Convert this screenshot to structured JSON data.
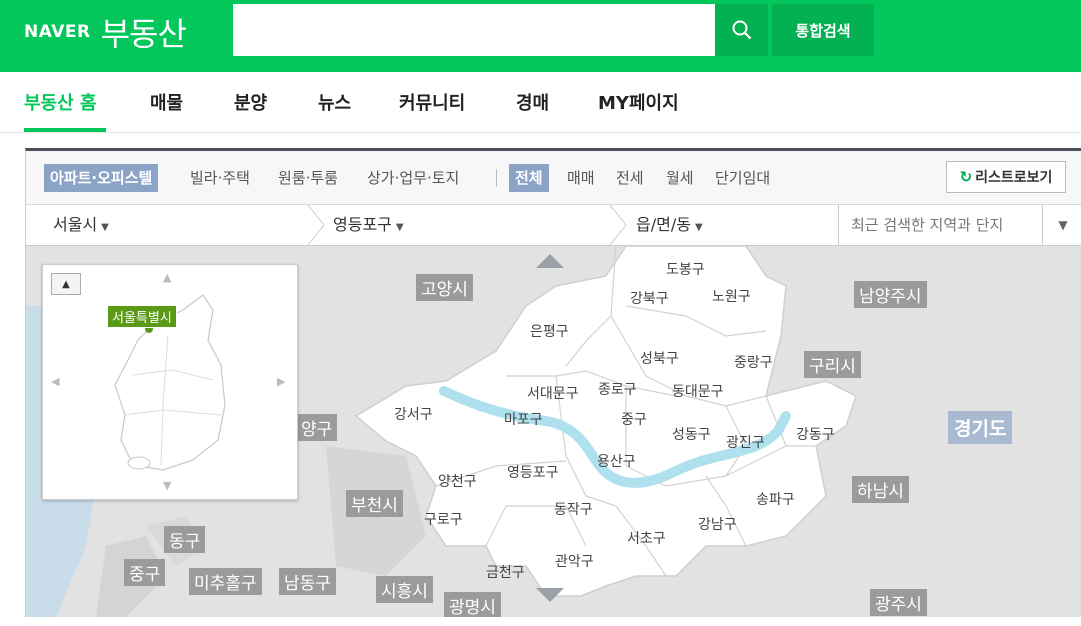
{
  "header": {
    "brand": "NAVER",
    "service": "부동산",
    "search": {
      "value": "",
      "placeholder": ""
    },
    "search_button_icon": "search-icon",
    "total_search_label": "통합검색"
  },
  "nav": {
    "items": [
      "부동산 홈",
      "매물",
      "분양",
      "뉴스",
      "커뮤니티",
      "경매",
      "MY페이지"
    ],
    "active": "부동산 홈"
  },
  "filters": {
    "property_types": [
      "아파트·오피스텔",
      "빌라·주택",
      "원룸·투룸",
      "상가·업무·토지"
    ],
    "selected_type": "아파트·오피스텔",
    "trade_types": [
      "전체",
      "매매",
      "전세",
      "월세",
      "단기임대"
    ],
    "selected_trade": "전체",
    "list_view_label": "리스트로보기",
    "list_view_icon": "refresh-icon"
  },
  "regions": {
    "city": "서울시",
    "district": "영등포구",
    "dong": "읍/면/동",
    "recent_placeholder": "최근 검색한 지역과 단지"
  },
  "map": {
    "gray_labels": [
      "고양시",
      "남양주시",
      "구리시",
      "하남시",
      "부천시",
      "양구",
      "동구",
      "중구",
      "미추홀구",
      "남동구",
      "시흥시",
      "광명시",
      "광주시"
    ],
    "province_label": "경기도",
    "districts": [
      "도봉구",
      "강북구",
      "노원구",
      "은평구",
      "성북구",
      "중랑구",
      "서대문구",
      "종로구",
      "동대문구",
      "강서구",
      "마포구",
      "중구",
      "성동구",
      "광진구",
      "강동구",
      "용산구",
      "영등포구",
      "양천구",
      "송파구",
      "구로구",
      "동작구",
      "강남구",
      "서초구",
      "관악구",
      "금천구"
    ],
    "minimap_label": "서울특별시",
    "colors": {
      "water": "#aee0ee",
      "seoul_fill": "#ffffff",
      "land": "#e2e2e2",
      "sea": "#c9dcea"
    }
  },
  "colors": {
    "brand_green": "#03c75a",
    "selected_filter": "#8aa3c7"
  }
}
